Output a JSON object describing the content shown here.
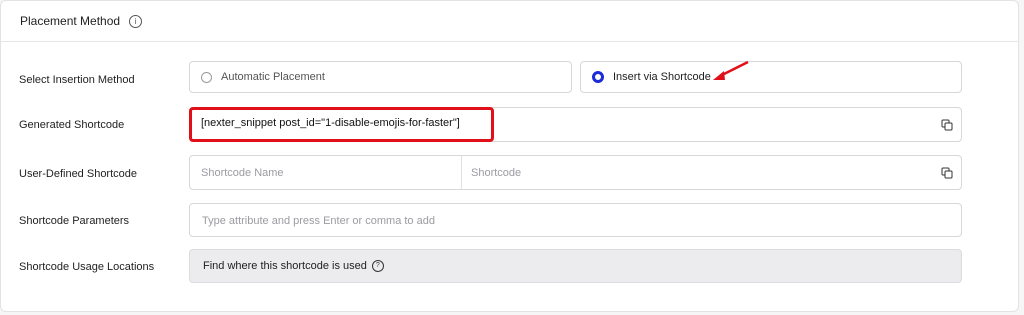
{
  "header": {
    "title": "Placement Method",
    "info_icon": "info-icon"
  },
  "rows": {
    "insertion": {
      "label": "Select Insertion Method",
      "options": [
        "Automatic Placement",
        "Insert via Shortcode"
      ],
      "selected": "Insert via Shortcode"
    },
    "generated": {
      "label": "Generated Shortcode",
      "value": "[nexter_snippet post_id=\"1-disable-emojis-for-faster\"]"
    },
    "user_defined": {
      "label": "User-Defined Shortcode",
      "name_placeholder": "Shortcode Name",
      "shortcode_placeholder": "Shortcode"
    },
    "parameters": {
      "label": "Shortcode Parameters",
      "placeholder": "Type attribute and press Enter or comma to add"
    },
    "usage": {
      "label": "Shortcode Usage Locations",
      "button_text": "Find where this shortcode is used"
    }
  },
  "colors": {
    "accent": "#1c2bd8",
    "highlight": "#e0101a"
  }
}
